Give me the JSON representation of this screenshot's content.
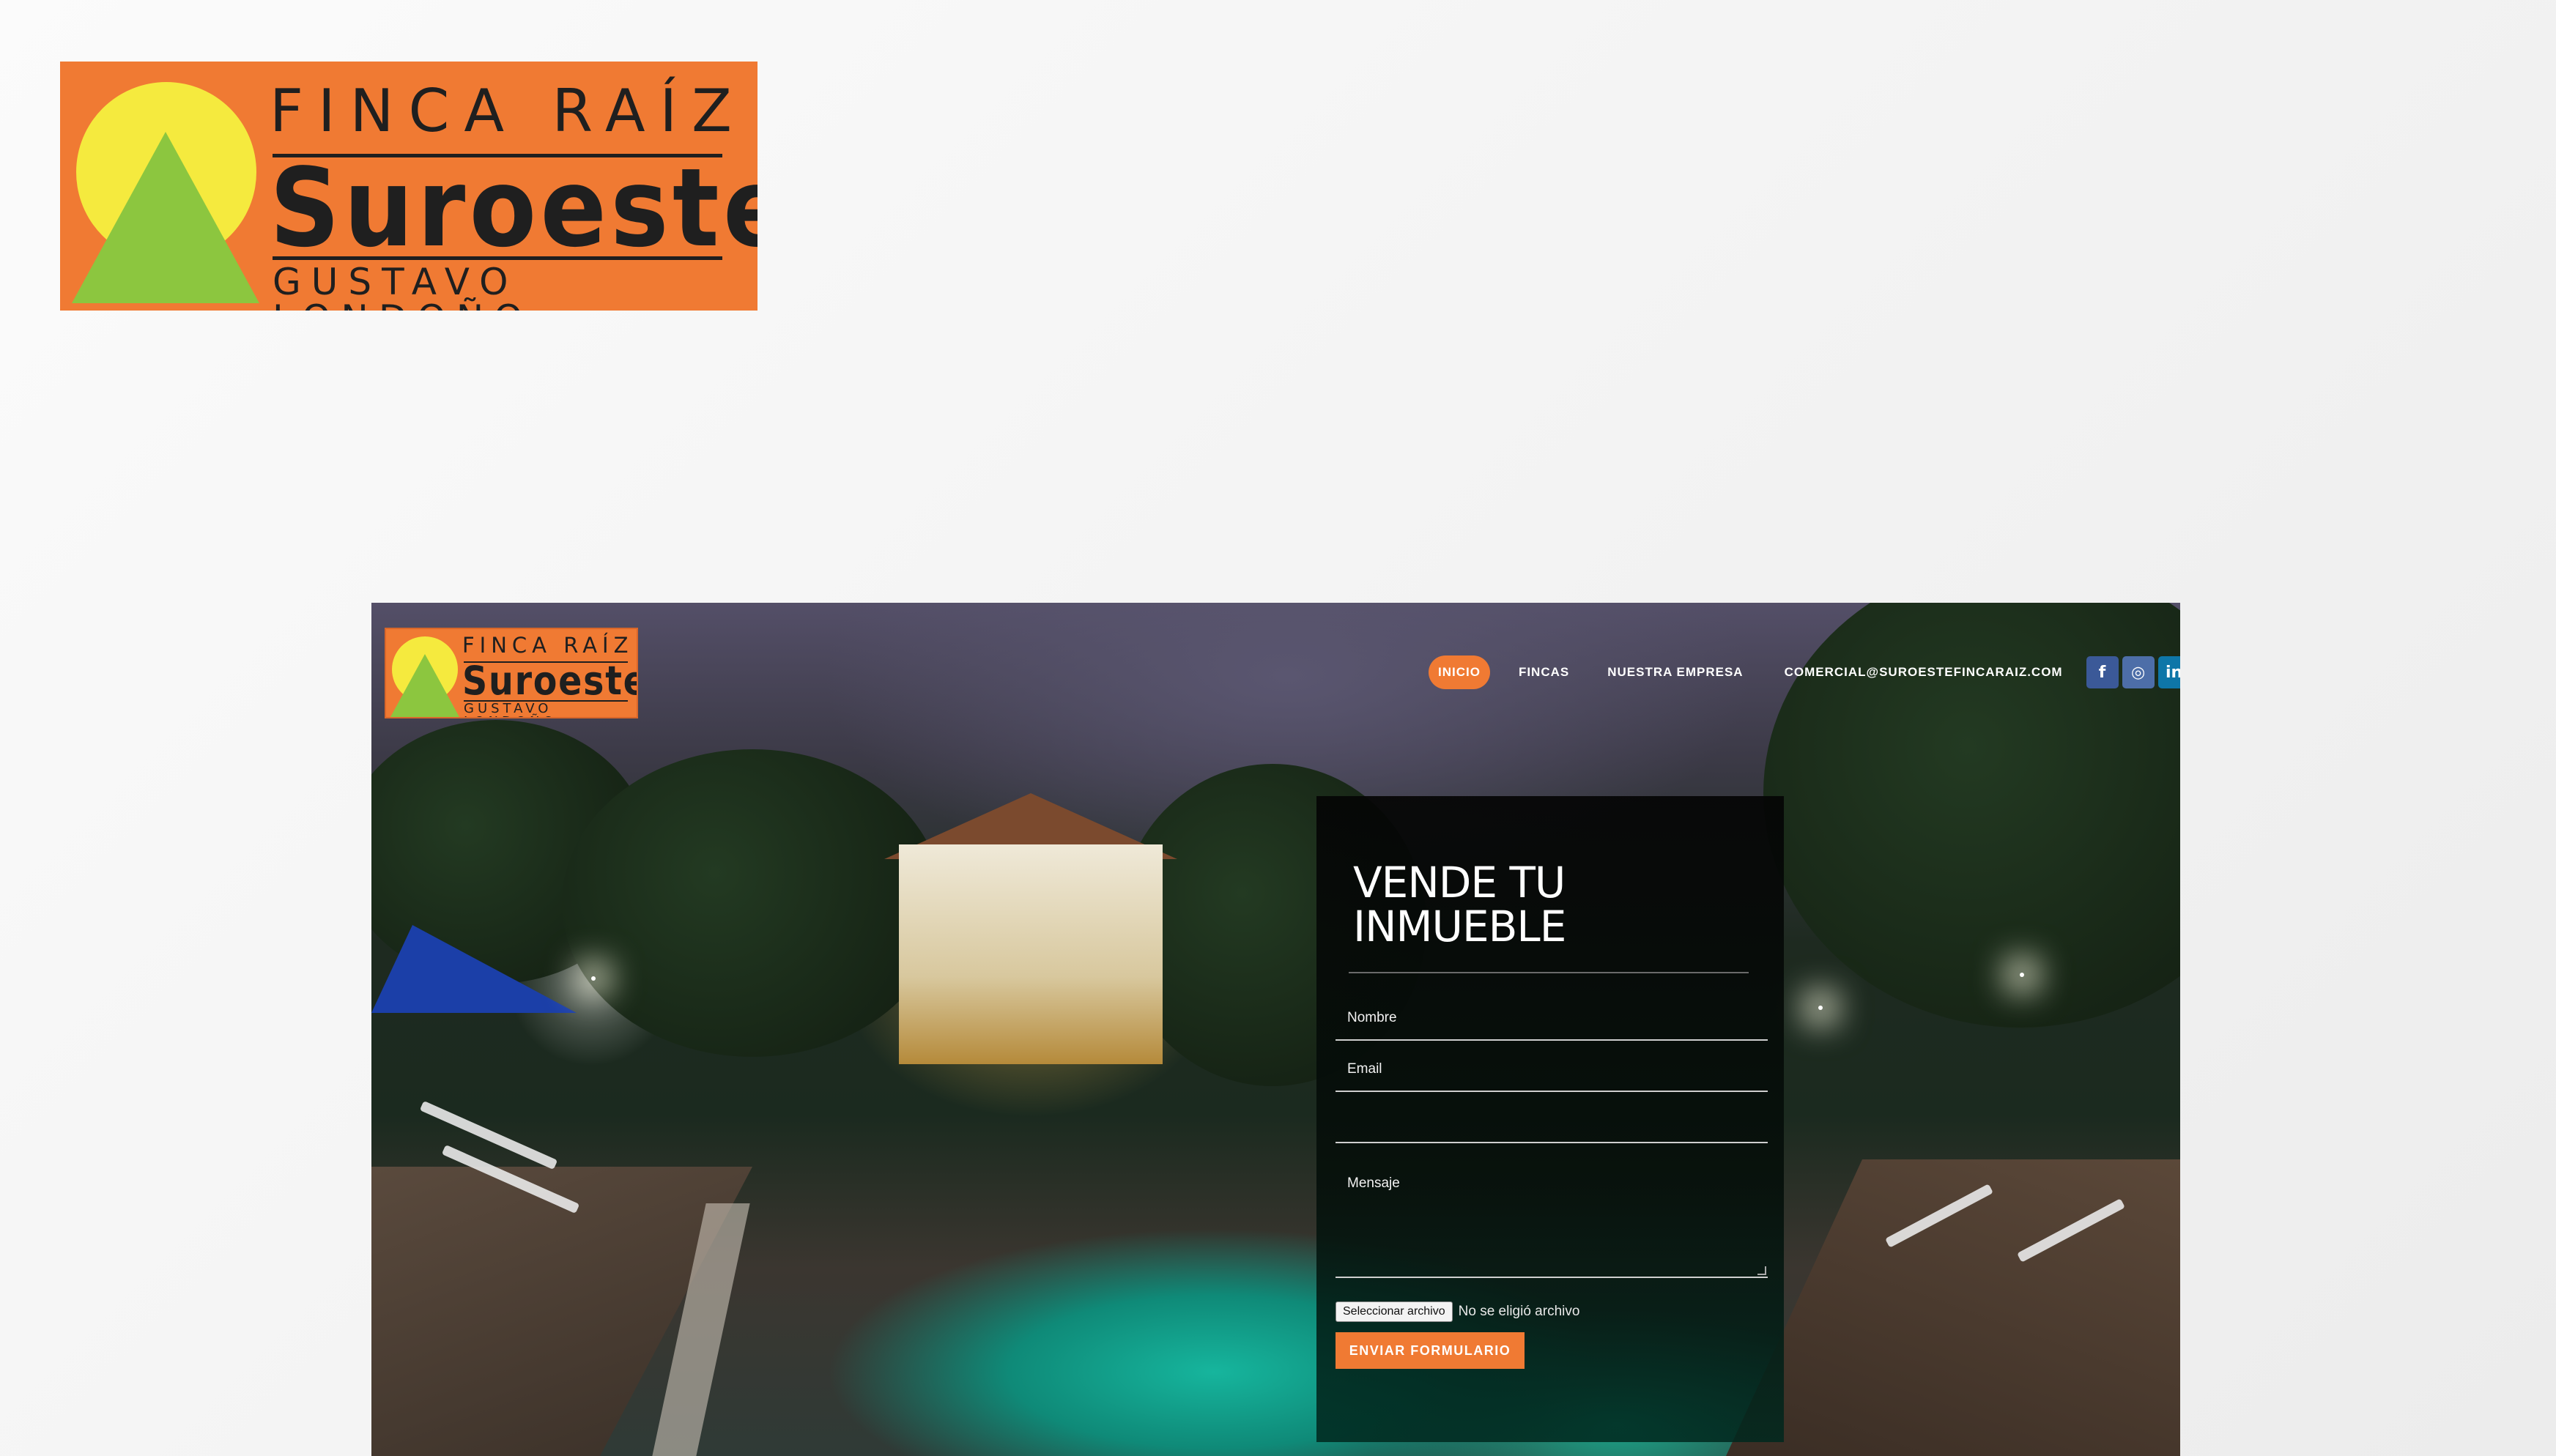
{
  "logo": {
    "line1": "FINCA RAÍZ",
    "line2": "Suroeste",
    "line3": "GUSTAVO LONDOÑO"
  },
  "nav": {
    "items": [
      {
        "label": "INICIO",
        "active": true
      },
      {
        "label": "FINCAS",
        "active": false
      },
      {
        "label": "NUESTRA EMPRESA",
        "active": false
      },
      {
        "label": "COMERCIAL@SUROESTEFINCARAIZ.COM",
        "active": false
      }
    ],
    "socials": [
      {
        "icon": "facebook-icon",
        "glyph": "f",
        "color": "#3b5998"
      },
      {
        "icon": "instagram-icon",
        "glyph": "◎",
        "color": "#4d6ea8"
      },
      {
        "icon": "linkedin-icon",
        "glyph": "in",
        "color": "#0e76a8"
      }
    ]
  },
  "form": {
    "title": "VENDE TU\nINMUEBLE",
    "fields": {
      "name_placeholder": "Nombre",
      "email_placeholder": "Email",
      "third_placeholder": "",
      "message_placeholder": "Mensaje"
    },
    "file_button": "Seleccionar archivo",
    "file_status": "No se eligió archivo",
    "submit_label": "ENVIAR FORMULARIO"
  },
  "colors": {
    "brand_orange": "#f07a33",
    "sun_yellow": "#f5ea3e",
    "triangle_green": "#8cc63f"
  }
}
